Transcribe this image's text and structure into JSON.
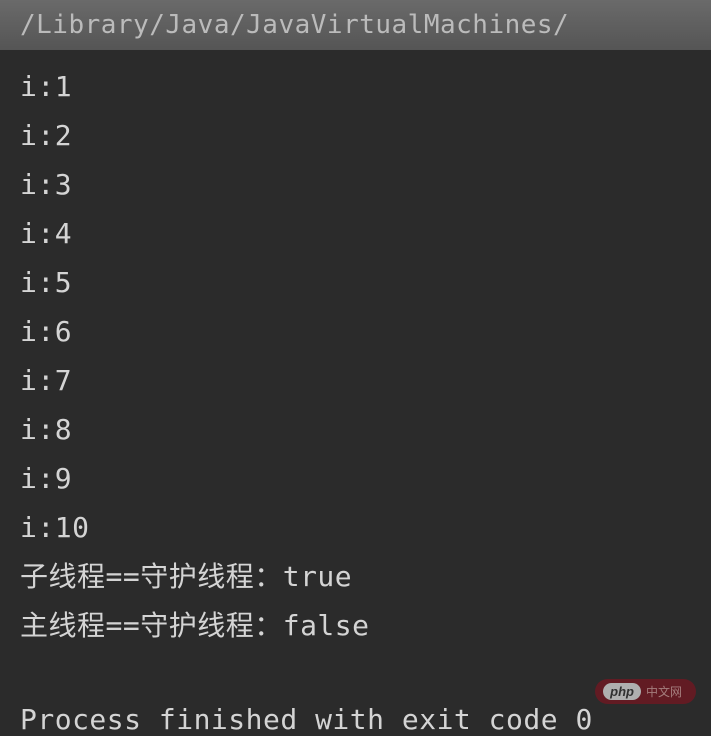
{
  "header": {
    "path": "/Library/Java/JavaVirtualMachines/"
  },
  "output": {
    "lines": [
      "i:1",
      "i:2",
      "i:3",
      "i:4",
      "i:5",
      "i:6",
      "i:7",
      "i:8",
      "i:9",
      "i:10",
      "子线程==守护线程：true",
      "主线程==守护线程：false"
    ],
    "exit_message": "Process finished with exit code 0"
  },
  "watermark": {
    "label": "php",
    "suffix": "中文网"
  }
}
